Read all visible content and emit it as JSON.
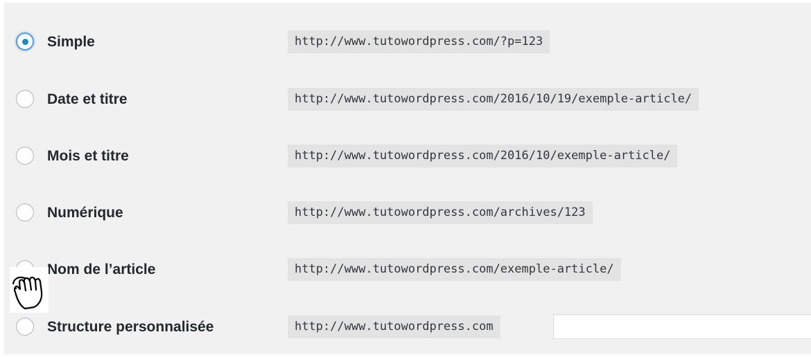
{
  "permalinks": {
    "options": [
      {
        "label": "Simple",
        "url": "http://www.tutowordpress.com/?p=123",
        "checked": true
      },
      {
        "label": "Date et titre",
        "url": "http://www.tutowordpress.com/2016/10/19/exemple-article/",
        "checked": false
      },
      {
        "label": "Mois et titre",
        "url": "http://www.tutowordpress.com/2016/10/exemple-article/",
        "checked": false
      },
      {
        "label": "Numérique",
        "url": "http://www.tutowordpress.com/archives/123",
        "checked": false
      },
      {
        "label": "Nom de l’article",
        "url": "http://www.tutowordpress.com/exemple-article/",
        "checked": false
      },
      {
        "label": "Structure personnalisée",
        "url": "http://www.tutowordpress.com",
        "checked": false
      }
    ],
    "custom_structure_value": ""
  },
  "colors": {
    "panel_background": "#f1f1f1",
    "code_background": "#e3e3e3",
    "radio_checked": "#1e8cbe",
    "label_text": "#23282d"
  },
  "icons": {
    "cursor": "hand-pointer-icon"
  }
}
